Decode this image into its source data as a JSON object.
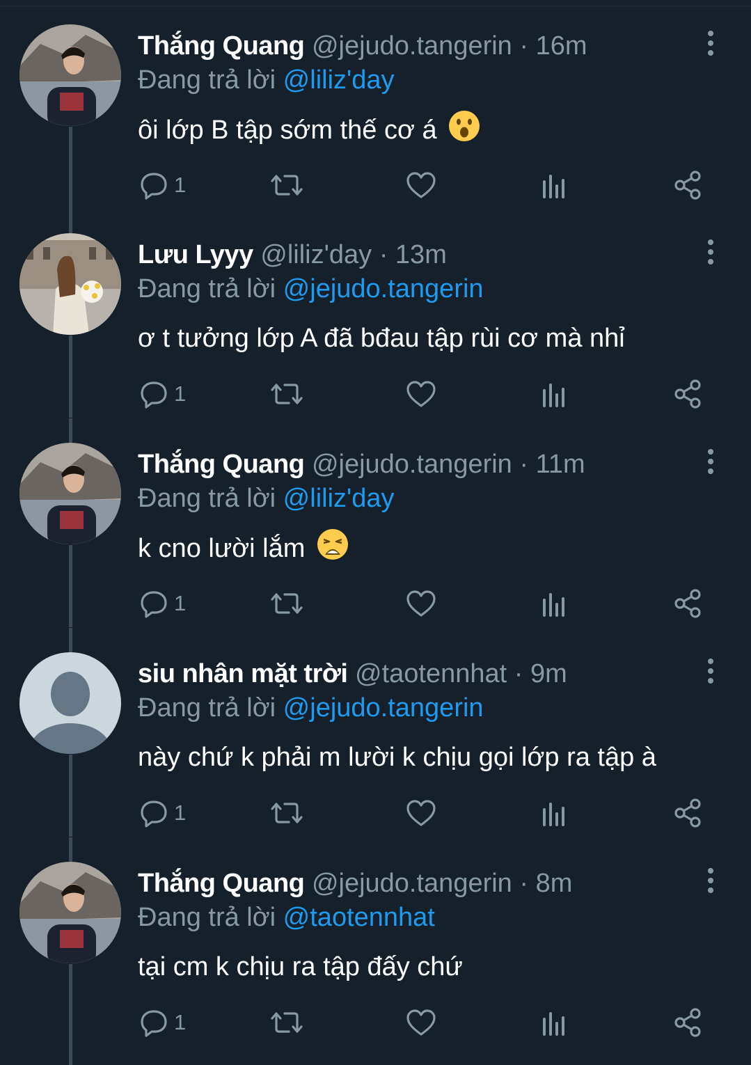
{
  "theme": {
    "background": "#15202b",
    "text": "#ffffff",
    "muted": "#8899a6",
    "accent": "#1d9bf0",
    "thread_line": "#3d4a57"
  },
  "tweets": [
    {
      "display_name": "Thắng Quang",
      "handle": "@jejudo.tangerin",
      "separator": "·",
      "time": "16m",
      "replying_prefix": "Đang trả lời",
      "replying_to": "@liliz'day",
      "text": "ôi lớp B tập sớm thế cơ á",
      "emoji": "face-with-open-mouth",
      "reply_count": "1",
      "avatar": "photo-man-lakeside"
    },
    {
      "display_name": "Lưu Lyyy",
      "handle": "@liliz'day",
      "separator": "·",
      "time": "13m",
      "replying_prefix": "Đang trả lời",
      "replying_to": "@jejudo.tangerin",
      "text": "ơ t tưởng lớp A đã bđau tập rùi cơ mà nhỉ",
      "emoji": "",
      "reply_count": "1",
      "avatar": "photo-woman-flowers"
    },
    {
      "display_name": "Thắng Quang",
      "handle": "@jejudo.tangerin",
      "separator": "·",
      "time": "11m",
      "replying_prefix": "Đang trả lời",
      "replying_to": "@liliz'day",
      "text": "k cno lười lắm",
      "emoji": "weary-face",
      "reply_count": "1",
      "avatar": "photo-man-lakeside"
    },
    {
      "display_name": "siu nhân mặt trời",
      "handle": "@taotennhat",
      "separator": "·",
      "time": "9m",
      "replying_prefix": "Đang trả lời",
      "replying_to": "@jejudo.tangerin",
      "text": "này chứ k phải m lười k chịu gọi lớp ra tập à",
      "emoji": "",
      "reply_count": "1",
      "avatar": "default-profile"
    },
    {
      "display_name": "Thắng Quang",
      "handle": "@jejudo.tangerin",
      "separator": "·",
      "time": "8m",
      "replying_prefix": "Đang trả lời",
      "replying_to": "@taotennhat",
      "text": "tại cm k chịu ra tập đấy chứ",
      "emoji": "",
      "reply_count": "1",
      "avatar": "photo-man-lakeside"
    }
  ]
}
